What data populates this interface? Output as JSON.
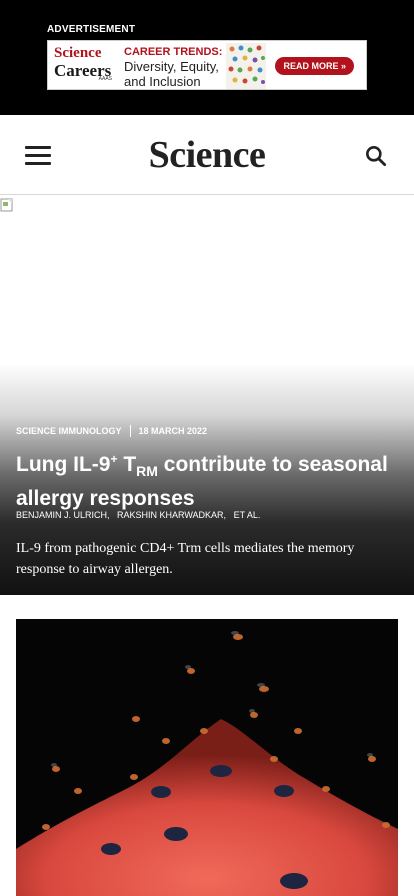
{
  "ad": {
    "label": "ADVERTISEMENT",
    "logo_line1": "Science",
    "logo_line2": "Careers",
    "logo_line3": "AAAS",
    "headline": "CAREER TRENDS:",
    "line2": "Diversity, Equity,",
    "line3": "and Inclusion",
    "cta": "READ MORE »",
    "accent": "#b1121b"
  },
  "header": {
    "logo": "Science",
    "menu_icon": "hamburger-menu-icon",
    "search_icon": "search-icon"
  },
  "hero": {
    "journal": "SCIENCE IMMUNOLOGY",
    "date": "18 MARCH 2022",
    "title_part1": "Lung IL-9",
    "title_sup1": "+",
    "title_part2": " T",
    "title_sub": "RM",
    "title_part3": " contribute to seasonal allergy responses",
    "authors": [
      "BENJAMIN J. ULRICH,",
      "RAKSHIN KHARWADKAR,",
      "ET AL."
    ],
    "description": "IL-9 from pathogenic CD4+ Trm cells mediates the memory response to airway allergen."
  }
}
